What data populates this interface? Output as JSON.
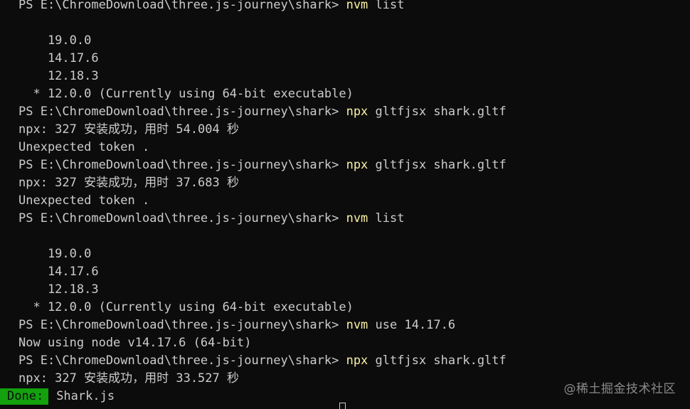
{
  "terminal": {
    "lines": [
      {
        "type": "prompt",
        "prompt": "PS E:\\ChromeDownload\\three.js-journey\\shark> ",
        "cmd": "nvm",
        "args": " list"
      },
      {
        "type": "text",
        "text": ""
      },
      {
        "type": "text",
        "text": "    19.0.0"
      },
      {
        "type": "text",
        "text": "    14.17.6"
      },
      {
        "type": "text",
        "text": "    12.18.3"
      },
      {
        "type": "text",
        "text": "  * 12.0.0 (Currently using 64-bit executable)"
      },
      {
        "type": "prompt",
        "prompt": "PS E:\\ChromeDownload\\three.js-journey\\shark> ",
        "cmd": "npx",
        "args": " gltfjsx shark.gltf"
      },
      {
        "type": "text",
        "text": "npx: 327 安装成功，用时 54.004 秒"
      },
      {
        "type": "text",
        "text": "Unexpected token ."
      },
      {
        "type": "prompt",
        "prompt": "PS E:\\ChromeDownload\\three.js-journey\\shark> ",
        "cmd": "npx",
        "args": " gltfjsx shark.gltf"
      },
      {
        "type": "text",
        "text": "npx: 327 安装成功，用时 37.683 秒"
      },
      {
        "type": "text",
        "text": "Unexpected token ."
      },
      {
        "type": "prompt",
        "prompt": "PS E:\\ChromeDownload\\three.js-journey\\shark> ",
        "cmd": "nvm",
        "args": " list"
      },
      {
        "type": "text",
        "text": ""
      },
      {
        "type": "text",
        "text": "    19.0.0"
      },
      {
        "type": "text",
        "text": "    14.17.6"
      },
      {
        "type": "text",
        "text": "    12.18.3"
      },
      {
        "type": "text",
        "text": "  * 12.0.0 (Currently using 64-bit executable)"
      },
      {
        "type": "prompt",
        "prompt": "PS E:\\ChromeDownload\\three.js-journey\\shark> ",
        "cmd": "nvm",
        "args": " use 14.17.6"
      },
      {
        "type": "text",
        "text": "Now using node v14.17.6 (64-bit)"
      },
      {
        "type": "prompt",
        "prompt": "PS E:\\ChromeDownload\\three.js-journey\\shark> ",
        "cmd": "npx",
        "args": " gltfjsx shark.gltf"
      },
      {
        "type": "text",
        "text": "npx: 327 安装成功，用时 33.527 秒"
      },
      {
        "type": "done",
        "badge": "Done:",
        "text": "Shark.js"
      }
    ]
  },
  "watermark": "@稀土掘金技术社区",
  "colors": {
    "background": "#0c0c0c",
    "text": "#cccccc",
    "command": "#f9f1a5",
    "done_badge": "#13a10e"
  }
}
